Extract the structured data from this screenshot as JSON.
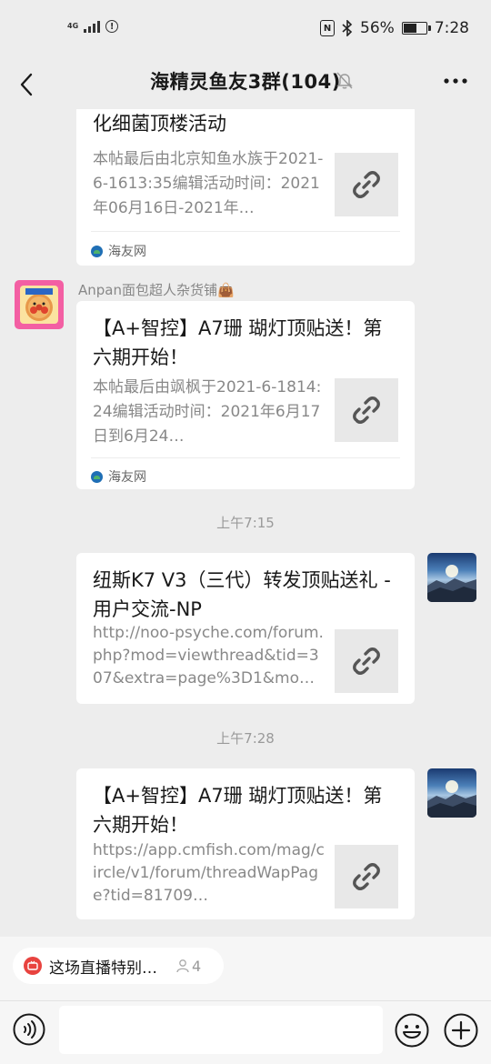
{
  "status_bar": {
    "network": "4G",
    "battery_percent": "56%",
    "battery_level": 0.56,
    "time": "7:28"
  },
  "nav": {
    "title": "海精灵鱼友3群(104)",
    "back_icon": "chevron-left-icon",
    "mute_icon": "bell-off-icon",
    "more_icon": "more-dots-icon"
  },
  "messages": [
    {
      "title": "Aquaforest紫色森林Bio-S复合硝化细菌顶楼活动",
      "desc": "本帖最后由北京知鱼水族于2021-6-1613:35编辑活动时间：2021年06月16日-2021年…",
      "source": "海友网"
    },
    {
      "sender": "Anpan面包超人杂货铺👜",
      "title": "【A+智控】A7珊 瑚灯顶贴送！第六期开始！",
      "desc": "本帖最后由飒枫于2021-6-1814:24编辑活动时间：2021年6月17日到6月24…",
      "source": "海友网"
    },
    {
      "timestamp": "上午7:15",
      "title": "纽斯K7 V3（三代）转发顶贴送礼 - 用户交流-NP",
      "desc": "http://noo-psyche.com/forum.php?mod=viewthread&tid=307&extra=page%3D1&mo…"
    },
    {
      "timestamp": "上午7:28",
      "title": "【A+智控】A7珊 瑚灯顶贴送！第六期开始！",
      "desc": "https://app.cmfish.com/mag/circle/v1/forum/threadWapPage?tid=81709…"
    }
  ],
  "live": {
    "text": "这场直播特别…",
    "count": "4"
  },
  "input": {
    "placeholder": ""
  },
  "colors": {
    "background": "#ededed",
    "card": "#ffffff",
    "muted_text": "#888888",
    "live_red": "#e8433f"
  }
}
